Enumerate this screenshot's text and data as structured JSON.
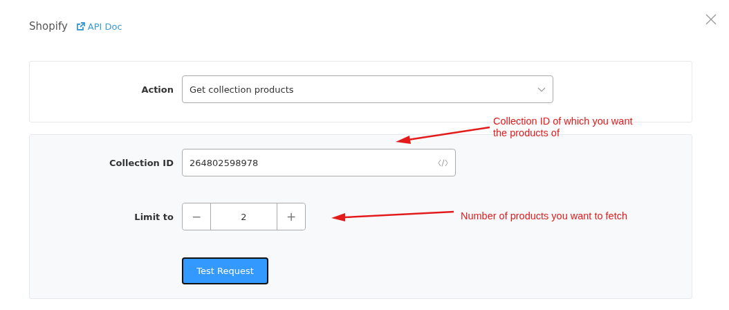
{
  "header": {
    "title": "Shopify",
    "link": "API Doc"
  },
  "action": {
    "label": "Action",
    "value": "Get collection products"
  },
  "collection_id": {
    "label": "Collection ID",
    "value": "264802598978"
  },
  "limit": {
    "label": "Limit to",
    "decrement": "−",
    "value": "2",
    "increment": "+"
  },
  "submit": {
    "label": "Test Request"
  },
  "annotations": [
    {
      "text": "Collection ID of which you want the products of"
    },
    {
      "text": "Number of products you want to fetch"
    }
  ]
}
